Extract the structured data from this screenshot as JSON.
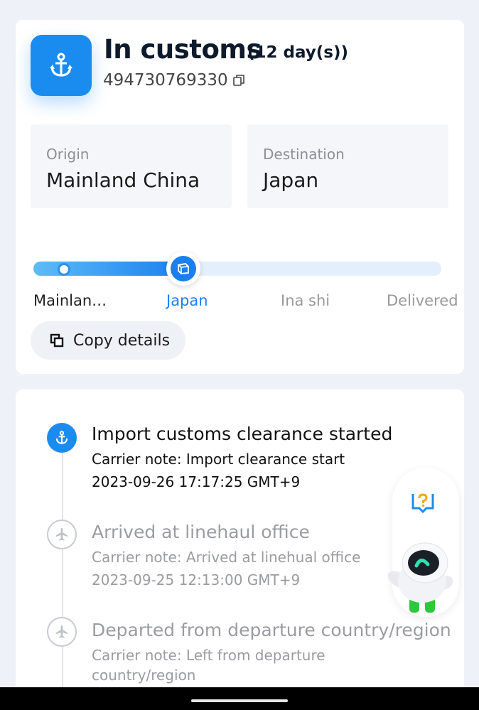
{
  "status": {
    "title": "In customs",
    "days": "(12 day(s))",
    "tracking_number": "494730769330",
    "icon": "anchor-icon"
  },
  "route": {
    "origin_label": "Origin",
    "origin_value": "Mainland China",
    "destination_label": "Destination",
    "destination_value": "Japan"
  },
  "progress": {
    "current_stage_index": 1,
    "fill_fraction": 0.375,
    "stages": [
      "Mainlan…",
      "Japan",
      "Ina shi",
      "Delivered"
    ]
  },
  "actions": {
    "copy_details_label": "Copy details"
  },
  "events": [
    {
      "title": "Import customs clearance started",
      "note": "Carrier note: Import clearance start",
      "time": "2023-09-26 17:17:25 GMT+9",
      "icon": "anchor-icon",
      "active": true
    },
    {
      "title": "Arrived at linehaul office",
      "note": "Carrier note: Arrived at linehual office",
      "time": "2023-09-25 12:13:00 GMT+9",
      "icon": "airplane-icon",
      "active": false
    },
    {
      "title": "Departed from departure country/region",
      "note": "Carrier note: Left from departure country/region",
      "time": "",
      "icon": "airplane-icon",
      "active": false
    }
  ],
  "colors": {
    "accent": "#1a8cf0",
    "background": "#eef1f7",
    "card": "#ffffff"
  }
}
